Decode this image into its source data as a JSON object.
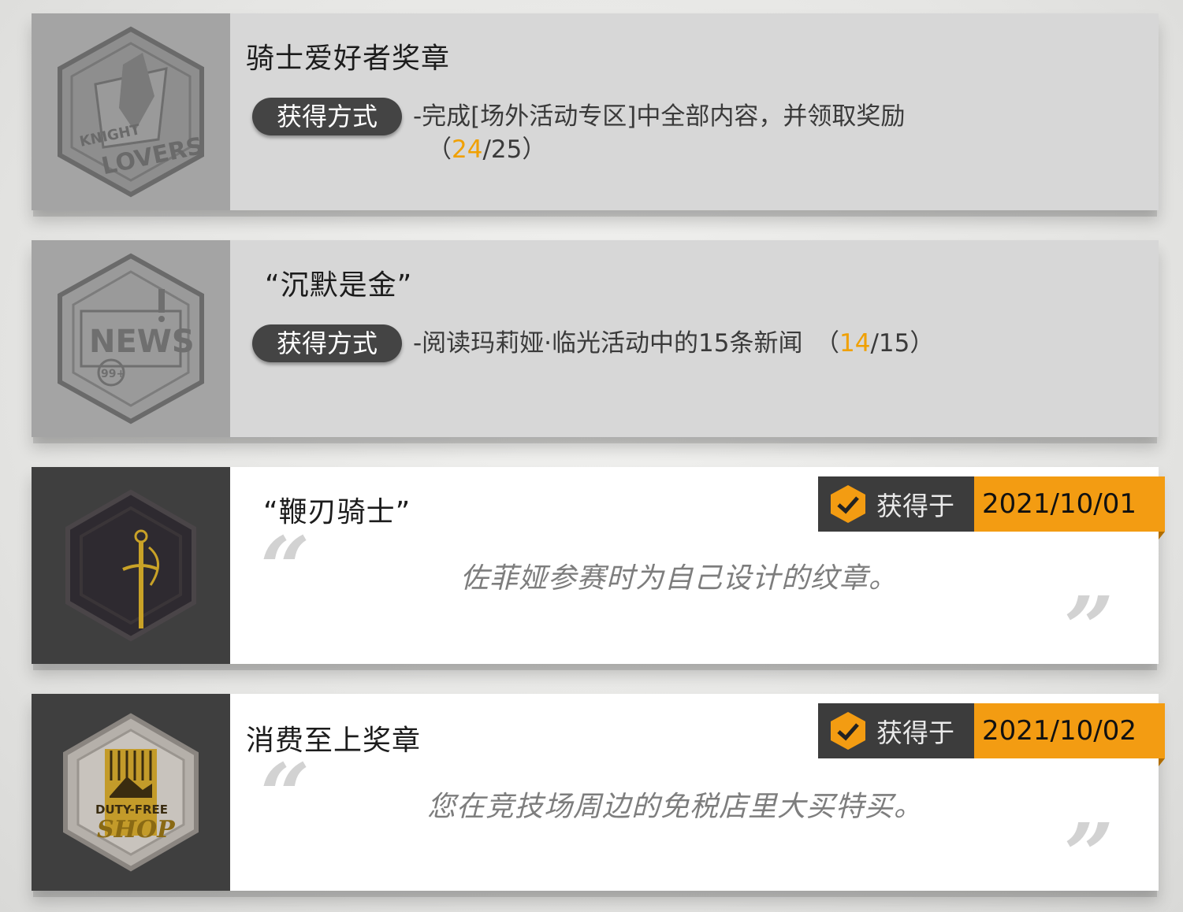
{
  "labels": {
    "method": "获得方式",
    "acquired": "获得于"
  },
  "colors": {
    "accent": "#f39c12",
    "highlight": "#f0a000",
    "locked_bg": "#d7d7d7",
    "owned_bg": "#ffffff"
  },
  "badges": [
    {
      "title": "骑士爱好者奖章",
      "method_text": "-完成[场外活动专区]中全部内容，并领取奖励",
      "progress_open": "（",
      "progress_current": "24",
      "progress_rest": "/25）",
      "icon": "knight-lovers-badge-icon",
      "icon_text": [
        "KNIGHT",
        "LOVERS"
      ],
      "status": "locked"
    },
    {
      "title": "“沉默是金”",
      "method_text": "-阅读玛莉娅·临光活动中的15条新闻　（",
      "progress_current": "14",
      "progress_rest": "/15）",
      "icon": "news-badge-icon",
      "icon_text": [
        "NEWS",
        "99+"
      ],
      "status": "locked"
    },
    {
      "title": "“鞭刃骑士”",
      "acquired_date": "2021/10/01",
      "description": "佐菲娅参赛时为自己设计的纹章。",
      "icon": "whip-blade-sword-badge-icon",
      "status": "owned"
    },
    {
      "title": "消费至上奖章",
      "acquired_date": "2021/10/02",
      "description": "您在竞技场周边的免税店里大买特买。",
      "icon": "duty-free-shop-badge-icon",
      "icon_text": [
        "DUTY-FREE",
        "SHOP"
      ],
      "status": "owned"
    }
  ]
}
